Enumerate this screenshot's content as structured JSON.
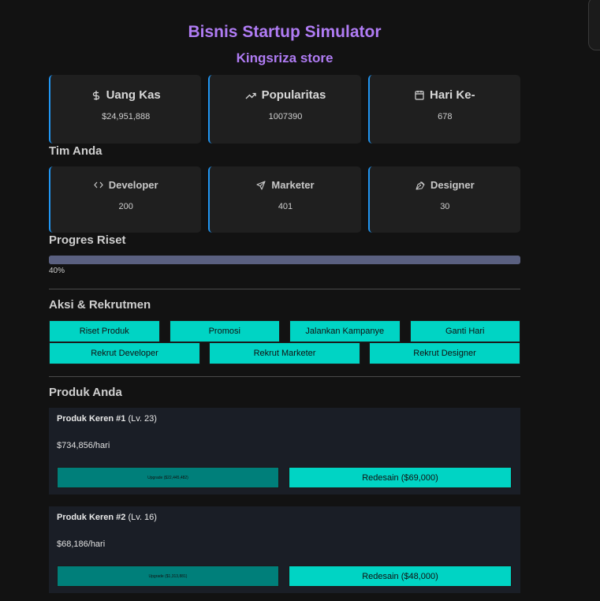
{
  "header": {
    "title": "Bisnis Startup Simulator",
    "store_name": "Kingsriza store"
  },
  "stats": [
    {
      "label": "Uang Kas",
      "value": "$24,951,888",
      "icon": "dollar-icon"
    },
    {
      "label": "Popularitas",
      "value": "1007390",
      "icon": "trending-up-icon"
    },
    {
      "label": "Hari Ke-",
      "value": "678",
      "icon": "calendar-icon"
    }
  ],
  "team": {
    "heading": "Tim Anda",
    "members": [
      {
        "label": "Developer",
        "value": "200",
        "icon": "code-icon"
      },
      {
        "label": "Marketer",
        "value": "401",
        "icon": "send-icon"
      },
      {
        "label": "Designer",
        "value": "30",
        "icon": "pen-tool-icon"
      }
    ]
  },
  "research": {
    "heading": "Progres Riset",
    "progress_percent": 40,
    "progress_label": "40%"
  },
  "actions": {
    "heading": "Aksi & Rekrutmen",
    "row1": [
      "Riset Produk",
      "Promosi",
      "Jalankan Kampanye",
      "Ganti Hari"
    ],
    "row2": [
      "Rekrut Developer",
      "Rekrut Marketer",
      "Rekrut Designer"
    ]
  },
  "products": {
    "heading": "Produk Anda",
    "items": [
      {
        "name": "Produk Keren #1",
        "level": "(Lv. 23)",
        "income": "$734,856/hari",
        "upgrade_label": "Upgrade ($22,445,482)",
        "redesign_label": "Redesain ($69,000)"
      },
      {
        "name": "Produk Keren #2",
        "level": "(Lv. 16)",
        "income": "$68,186/hari",
        "upgrade_label": "Upgrade ($1,313,881)",
        "redesign_label": "Redesain ($48,000)"
      }
    ]
  },
  "colors": {
    "background": "#121212",
    "accent_purple": "#b07cf4",
    "card_border": "#2196f3",
    "button_teal": "#00d4c4",
    "button_teal_dark": "#007f7a",
    "progress": "#5a6080"
  }
}
